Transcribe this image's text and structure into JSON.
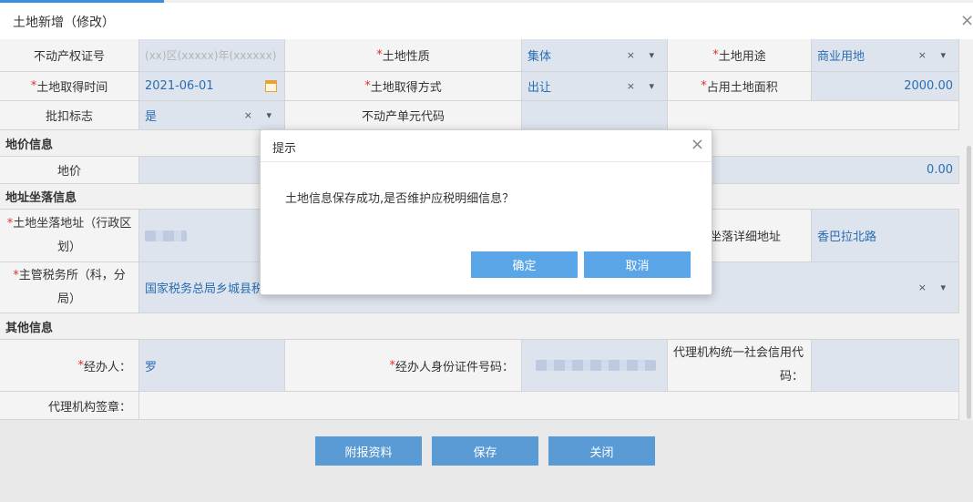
{
  "header": {
    "title": "土地新增（修改）",
    "close_glyph": "×"
  },
  "fields": {
    "cert_no": {
      "label": "不动产权证号",
      "placeholder": "(xx)区(xxxxx)年(xxxxxx)"
    },
    "land_nature": {
      "label": "土地性质",
      "value": "集体"
    },
    "land_use": {
      "label": "土地用途",
      "value": "商业用地"
    },
    "acquire_time": {
      "label": "土地取得时间",
      "value": "2021-06-01"
    },
    "acquire_method": {
      "label": "土地取得方式",
      "value": "出让"
    },
    "occupied_area": {
      "label": "占用土地面积",
      "value": "2000.00"
    },
    "approval_flag": {
      "label": "批扣标志",
      "value": "是"
    },
    "unit_code": {
      "label": "不动产单元代码",
      "value": ""
    }
  },
  "sections": {
    "price": "地价信息",
    "address": "地址坐落信息",
    "other": "其他信息"
  },
  "price": {
    "label": "地价",
    "value": "0.00"
  },
  "address": {
    "admin_area_label": "土地坐落地址（行政区划）",
    "detail_label": "地坐落详细地址",
    "detail_value": "香巴拉北路",
    "tax_office_label": "主管税务所（科，分局）",
    "tax_office_value": "国家税务总局乡城县税"
  },
  "other": {
    "handler_label": "经办人：",
    "handler_value": "罗",
    "handler_id_label": "经办人身份证件号码：",
    "agency_credit_label": "代理机构统一社会信用代码：",
    "agency_sign_label": "代理机构签章："
  },
  "required_mark": "*",
  "select_controls": "× ▾",
  "bottom_buttons": {
    "attach": "附报资料",
    "save": "保存",
    "close": "关闭"
  },
  "modal": {
    "title": "提示",
    "message": "土地信息保存成功,是否维护应税明细信息？",
    "confirm": "确定",
    "cancel": "取消",
    "close_glyph": "×"
  },
  "colors": {
    "accent": "#3b8fe0",
    "button": "#5a9bd5",
    "value_text": "#2a6db0",
    "required": "#e03030"
  }
}
